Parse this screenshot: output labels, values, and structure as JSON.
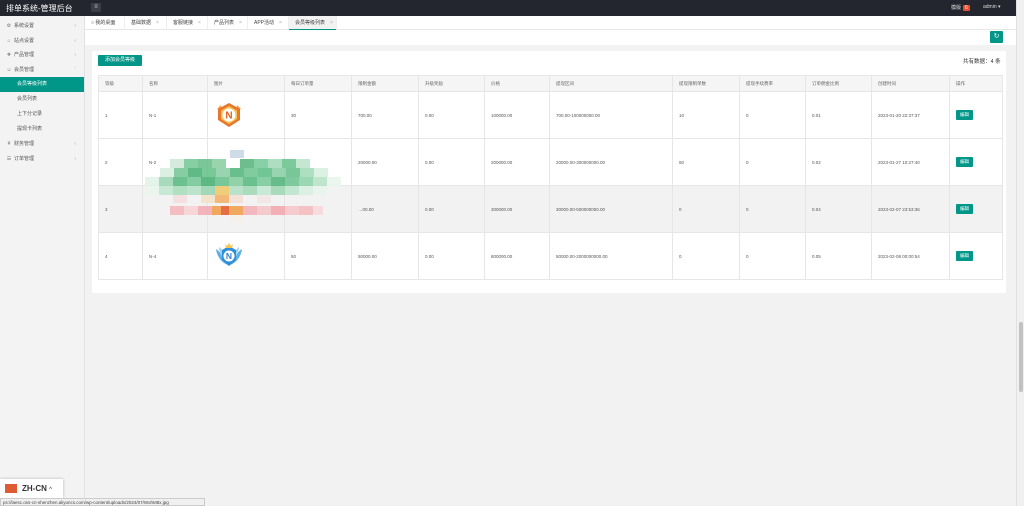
{
  "topbar": {
    "title": "排单系统-管理后台",
    "toggle_icon": "≡",
    "messages_label": "模版",
    "messages_count": "6",
    "user_label": "admin ▾"
  },
  "sidebar": {
    "items": [
      {
        "icon": "⚙",
        "label": "系统设置"
      },
      {
        "icon": "⌂",
        "label": "站点设置"
      },
      {
        "icon": "❖",
        "label": "产品管理"
      },
      {
        "icon": "☺",
        "label": "会员管理"
      }
    ],
    "member_sub": [
      {
        "label": "会员等级列表"
      },
      {
        "label": "会员列表"
      },
      {
        "label": "上下分记录"
      },
      {
        "label": "提现卡列表"
      }
    ],
    "items_after": [
      {
        "icon": "¥",
        "label": "财务管理"
      },
      {
        "icon": "☰",
        "label": "订单管理"
      }
    ]
  },
  "tabs": [
    {
      "label": "我的桌面"
    },
    {
      "label": "基础数据"
    },
    {
      "label": "客服链接"
    },
    {
      "label": "产品列表"
    },
    {
      "label": "APP活动"
    },
    {
      "label": "会员等级列表"
    }
  ],
  "toolbar": {
    "add_label": "添加会员等级",
    "total_label": "共有数据：",
    "total_count": "4",
    "total_unit": "条",
    "refresh_icon": "↻"
  },
  "table": {
    "headers": [
      "等级",
      "名称",
      "图片",
      "每日订单量",
      "限制金额",
      "升级奖励",
      "价格",
      "提现区间",
      "提现限制单数",
      "提现手续费率",
      "订单佣金比例",
      "创建时间",
      "操作"
    ],
    "rows": [
      {
        "level": "1",
        "name": "N-1",
        "daily": "30",
        "limit": "700.00",
        "reward": "0.00",
        "price": "100000.00",
        "range": "700.00-100000000.00",
        "wd_limit": "10",
        "fee": "0",
        "commission": "0.01",
        "created": "2023-01-20 22:37:37",
        "action": "编辑"
      },
      {
        "level": "2",
        "name": "N-2",
        "daily": "",
        "limit": "20000.00",
        "reward": "0.00",
        "price": "200000.00",
        "range": "20000.00-300000000.00",
        "wd_limit": "50",
        "fee": "0",
        "commission": "0.02",
        "created": "2023-01-27 10:27:40",
        "action": "编辑"
      },
      {
        "level": "3",
        "name": "",
        "daily": "",
        "limit": "…00.00",
        "reward": "0.00",
        "price": "300000.00",
        "range": "30000.00-500000000.00",
        "wd_limit": "0",
        "fee": "0",
        "commission": "0.04",
        "created": "2023-02-07 23:53:36",
        "action": "编辑"
      },
      {
        "level": "4",
        "name": "N-4",
        "daily": "50",
        "limit": "50000.00",
        "reward": "0.00",
        "price": "800000.00",
        "range": "50000.00-2000000000.00",
        "wd_limit": "0",
        "fee": "0",
        "commission": "0.05",
        "created": "2023-02-08 00:00:54",
        "action": "编辑"
      }
    ]
  },
  "language": {
    "code": "ZH-CN",
    "chevron": "^"
  },
  "status_url": "ps://laesc.oss-cn-shenzhen.aliyuncs.com/wp-content/uploads/2024/07/WohM8x.jpg",
  "colors": {
    "accent": "#009688",
    "topbar": "#23262e",
    "badge": "#e4502f"
  }
}
